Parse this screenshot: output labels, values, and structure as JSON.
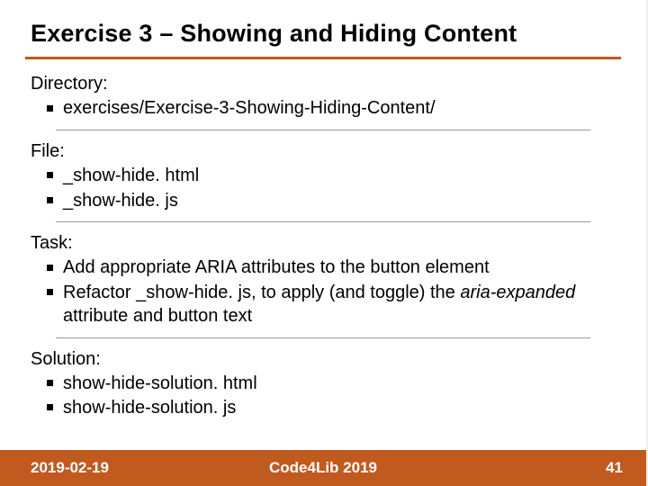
{
  "title": "Exercise 3 – Showing and Hiding Content",
  "sections": [
    {
      "label": "Directory:",
      "items": [
        "exercises/Exercise-3-Showing-Hiding-Content/"
      ]
    },
    {
      "label": "File:",
      "items": [
        "_show-hide. html",
        "_show-hide. js"
      ]
    },
    {
      "label": "Task:",
      "items": [
        "Add appropriate ARIA attributes to the button element",
        {
          "prefix": "Refactor _show-hide. js, to apply (and toggle) the ",
          "italic": "aria-expanded",
          "suffix": " attribute and button text"
        }
      ]
    },
    {
      "label": "Solution:",
      "items": [
        "show-hide-solution. html",
        "show-hide-solution. js"
      ]
    }
  ],
  "footer": {
    "date": "2019-02-19",
    "center": "Code4Lib 2019",
    "page": "41"
  },
  "colors": {
    "accent": "#c05a1f"
  }
}
